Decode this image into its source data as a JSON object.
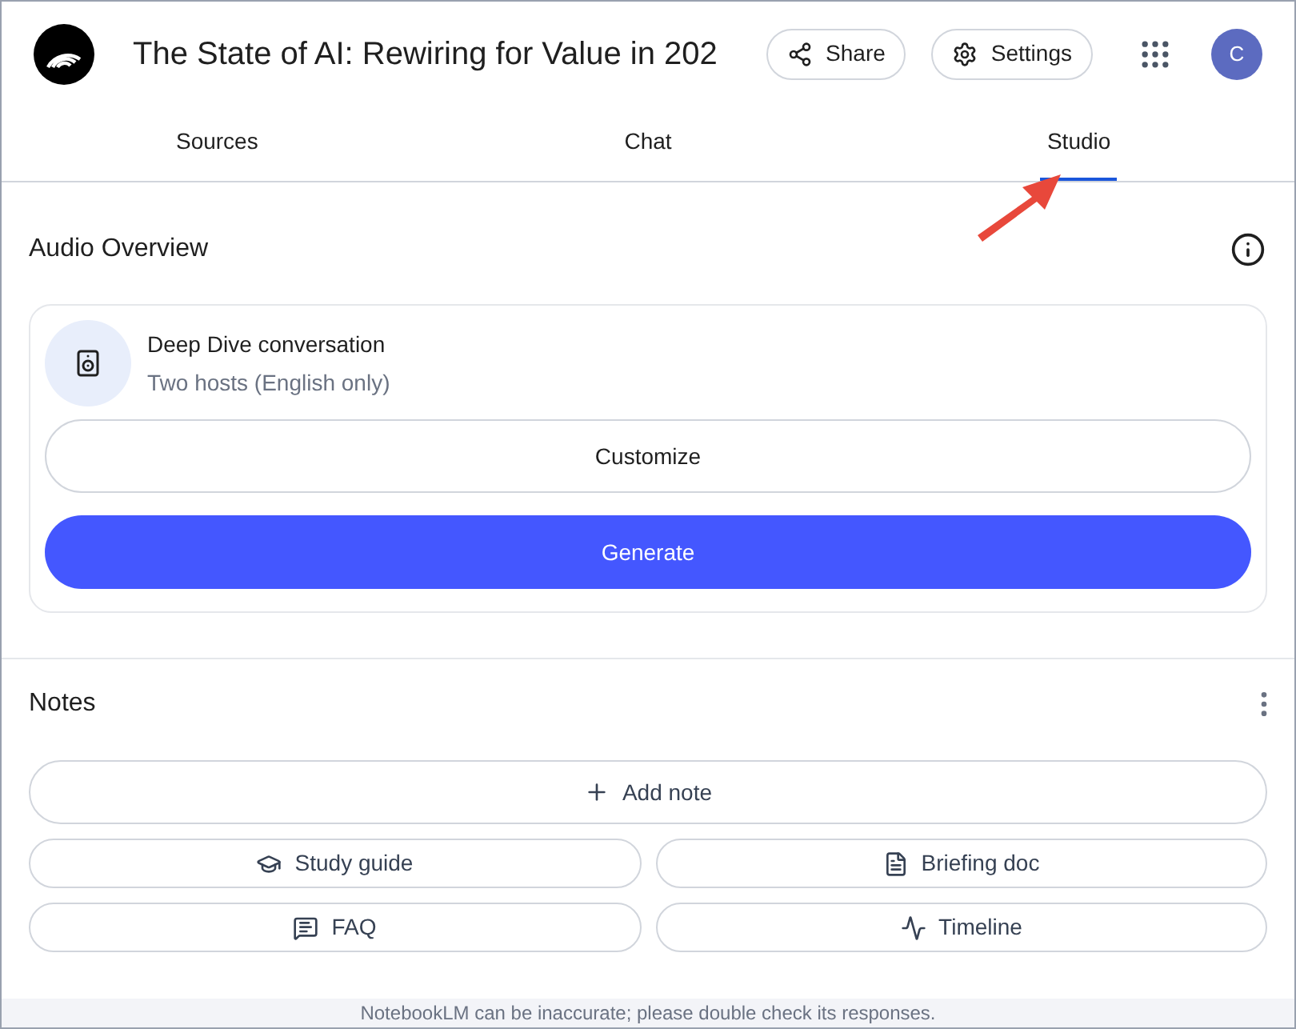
{
  "header": {
    "title": "The State of AI: Rewiring for Value in 202",
    "share": "Share",
    "settings": "Settings",
    "avatar": "C"
  },
  "tabs": [
    {
      "label": "Sources",
      "selected": false
    },
    {
      "label": "Chat",
      "selected": false
    },
    {
      "label": "Studio",
      "selected": true
    }
  ],
  "audio_overview": {
    "title": "Audio Overview",
    "item_title": "Deep Dive conversation",
    "item_subtitle": "Two hosts (English only)",
    "customize": "Customize",
    "generate": "Generate"
  },
  "notes": {
    "title": "Notes",
    "add_note": "Add note",
    "tools": [
      {
        "kind": "study",
        "label": "Study guide"
      },
      {
        "kind": "briefing",
        "label": "Briefing doc"
      },
      {
        "kind": "faq",
        "label": "FAQ"
      },
      {
        "kind": "timeline",
        "label": "Timeline"
      }
    ]
  },
  "footer": "NotebookLM can be inaccurate; please double check its responses."
}
